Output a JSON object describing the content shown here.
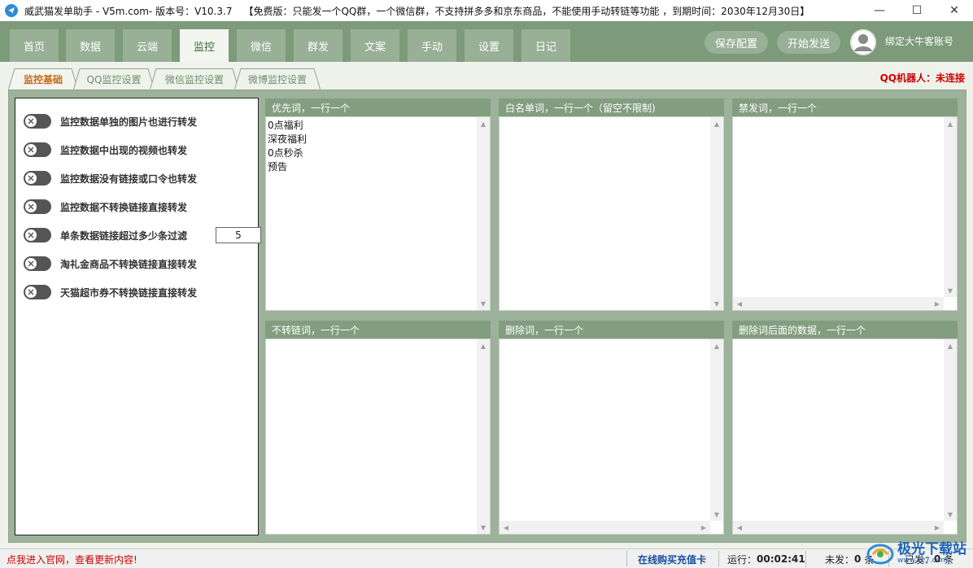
{
  "titlebar": {
    "title": "威武猫发单助手 - V5m.com- 版本号：V10.3.7",
    "notice": "【免费版：只能发一个QQ群，一个微信群，不支持拼多多和京东商品，不能使用手动转链等功能 ，到期时间：2030年12月30日】",
    "minimize": "—",
    "maximize": "☐",
    "close": "✕"
  },
  "nav": {
    "tabs": [
      "首页",
      "数据",
      "云端",
      "监控",
      "微信",
      "群发",
      "文案",
      "手动",
      "设置",
      "日记"
    ],
    "active_tab": "监控",
    "save_config": "保存配置",
    "start_send": "开始发送",
    "bind_account": "绑定大牛客账号"
  },
  "subtabs": {
    "items": [
      "监控基础",
      "QQ监控设置",
      "微信监控设置",
      "微博监控设置"
    ],
    "active": "监控基础"
  },
  "robot_status": "QQ机器人：未连接",
  "toggles": [
    {
      "label": "监控数据单独的图片也进行转发",
      "on": false
    },
    {
      "label": "监控数据中出现的视频也转发",
      "on": false
    },
    {
      "label": "监控数据没有链接或口令也转发",
      "on": false
    },
    {
      "label": "监控数据不转换链接直接转发",
      "on": false
    },
    {
      "label": "单条数据链接超过多少条过滤",
      "on": false
    },
    {
      "label": "淘礼金商品不转换链接直接转发",
      "on": false
    },
    {
      "label": "天猫超市券不转换链接直接转发",
      "on": false
    }
  ],
  "link_limit_value": "5",
  "boxes": [
    {
      "header": "优先词，一行一个",
      "lines": [
        "0点福利",
        "深夜福利",
        "0点秒杀",
        "预告"
      ]
    },
    {
      "header": "白名单词，一行一个（留空不限制)",
      "lines": []
    },
    {
      "header": "禁发词，一行一个",
      "lines": []
    },
    {
      "header": "不转链词，一行一个",
      "lines": []
    },
    {
      "header": "删除词，一行一个",
      "lines": []
    },
    {
      "header": "删除词后面的数据，一行一个",
      "lines": []
    }
  ],
  "statusbar": {
    "website_link": "点我进入官网，查看更新内容!",
    "buy_card": "在线购买充值卡",
    "runtime_label": "运行：",
    "runtime_value": "00:02:41",
    "unsent_label": "未发：",
    "unsent_value": "0",
    "unsent_unit": "条",
    "sent_label": "已发：",
    "sent_value": "0",
    "sent_unit": "条"
  },
  "watermark": {
    "text": "极光下载站",
    "url": "www.xz7.com"
  },
  "colors": {
    "nav_green": "#7d9a7b",
    "active_orange": "#c76b18",
    "alert_red": "#d00000",
    "link_blue": "#1a4fa0"
  }
}
